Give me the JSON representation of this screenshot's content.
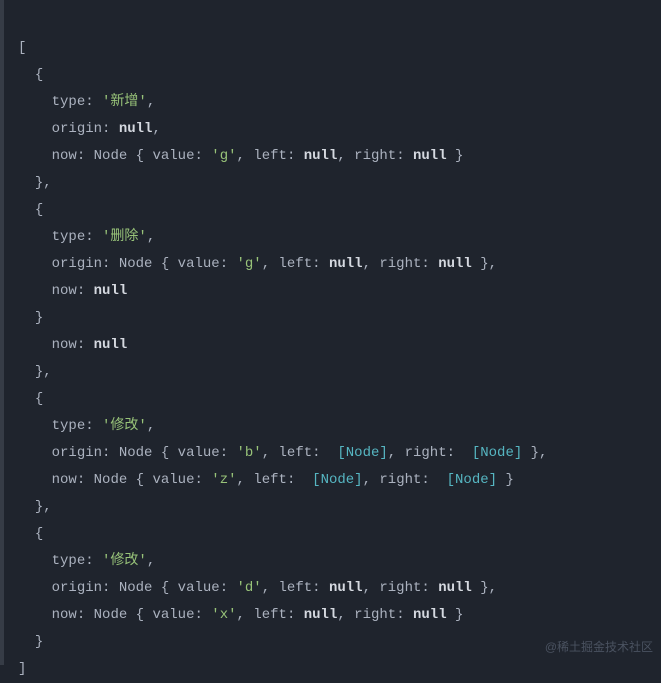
{
  "watermark": "@稀土掘金技术社区",
  "code": {
    "open": "[",
    "close": "]",
    "ind1": "  ",
    "ind2": "    ",
    "objOpen": "{",
    "objClose": "}",
    "objCloseComma": "},",
    "labels": {
      "type": "type",
      "origin": "origin",
      "now": "now",
      "value": "value",
      "left": "left",
      "right": "right",
      "Node": "Node"
    },
    "punct": {
      "colon": ": ",
      "comma": ",",
      "braceOpen": "{ ",
      "braceClose": " }",
      "braceCloseComma": " },",
      "bracketOpen": "[",
      "bracketClose": "]"
    },
    "vals": {
      "null": "null",
      "xinzeng": "'新增'",
      "shanchu": "'删除'",
      "xiugai": "'修改'",
      "g": "'g'",
      "b": "'b'",
      "z": "'z'",
      "d": "'d'",
      "x": "'x'",
      "NodeBr": "Node"
    }
  },
  "chart_data": {
    "type": "table",
    "title": "Diff result array (console output)",
    "columns": [
      "type",
      "origin",
      "now"
    ],
    "rows": [
      {
        "type": "新增",
        "origin": null,
        "now": {
          "value": "g",
          "left": null,
          "right": null
        }
      },
      {
        "type": "删除",
        "origin": {
          "value": "g",
          "left": null,
          "right": null
        },
        "now": null
      },
      {
        "type": "修改",
        "origin": {
          "value": "b",
          "left": "[Node]",
          "right": "[Node]"
        },
        "now": {
          "value": "z",
          "left": "[Node]",
          "right": "[Node]"
        }
      },
      {
        "type": "修改",
        "origin": {
          "value": "d",
          "left": null,
          "right": null
        },
        "now": {
          "value": "x",
          "left": null,
          "right": null
        }
      }
    ],
    "note": "extra dangling line 'now: null' and stray '}' present in original output between entries"
  }
}
